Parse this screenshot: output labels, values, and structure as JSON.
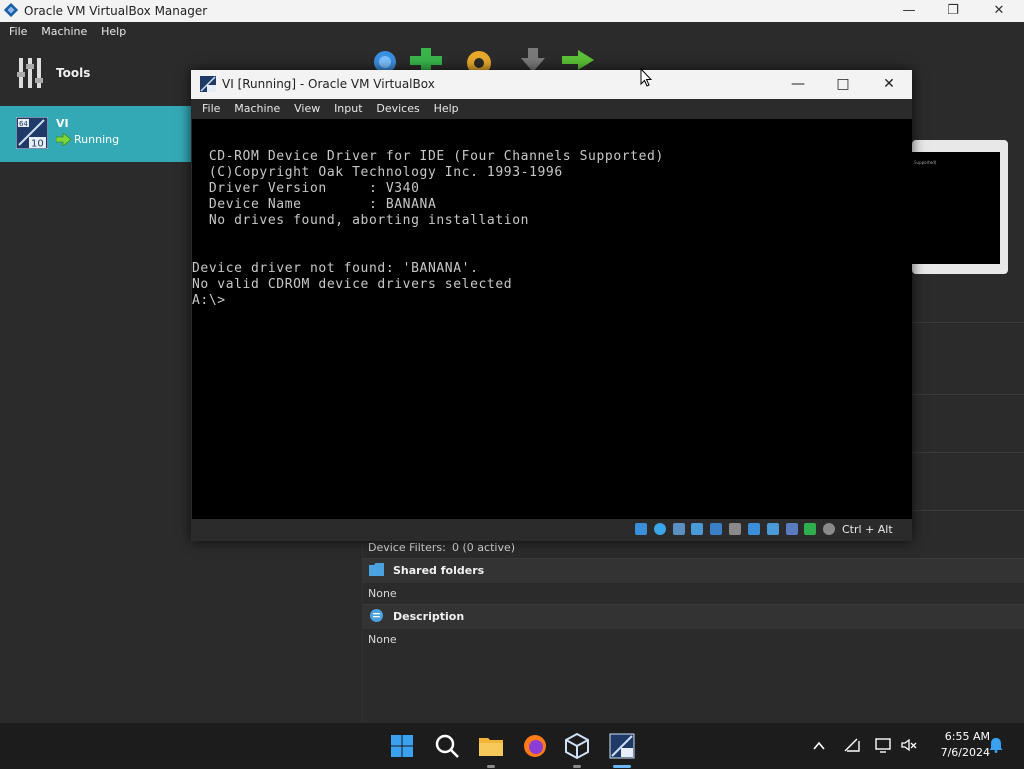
{
  "manager": {
    "title": "Oracle VM VirtualBox Manager",
    "menu": [
      "File",
      "Machine",
      "Help"
    ],
    "tools_label": "Tools",
    "vm": {
      "name": "VI",
      "state": "Running",
      "os_badge": "10",
      "os_bits": "64"
    },
    "details": {
      "usb_filters_label": "Device Filters:",
      "usb_filters_value": "0 (0 active)",
      "shared_folders_heading": "Shared folders",
      "shared_folders_value": "None",
      "description_heading": "Description",
      "description_value": "None"
    },
    "preview_text": "Supported)"
  },
  "vm_window": {
    "title": "VI [Running] - Oracle VM VirtualBox",
    "menu": [
      "File",
      "Machine",
      "View",
      "Input",
      "Devices",
      "Help"
    ],
    "console_lines": [
      "  CD-ROM Device Driver for IDE (Four Channels Supported)",
      "  (C)Copyright Oak Technology Inc. 1993-1996",
      "  Driver Version     : V340",
      "  Device Name        : BANANA",
      "  No drives found, aborting installation",
      "",
      "",
      "Device driver not found: 'BANANA'.",
      "No valid CDROM device drivers selected",
      "A:\\>"
    ],
    "host_key": "Ctrl + Alt"
  },
  "taskbar": {
    "time": "6:55 AM",
    "date": "7/6/2024"
  },
  "colors": {
    "selection": "#34a9b6",
    "background": "#2b2b2b",
    "taskbar": "#1c1c1c"
  }
}
